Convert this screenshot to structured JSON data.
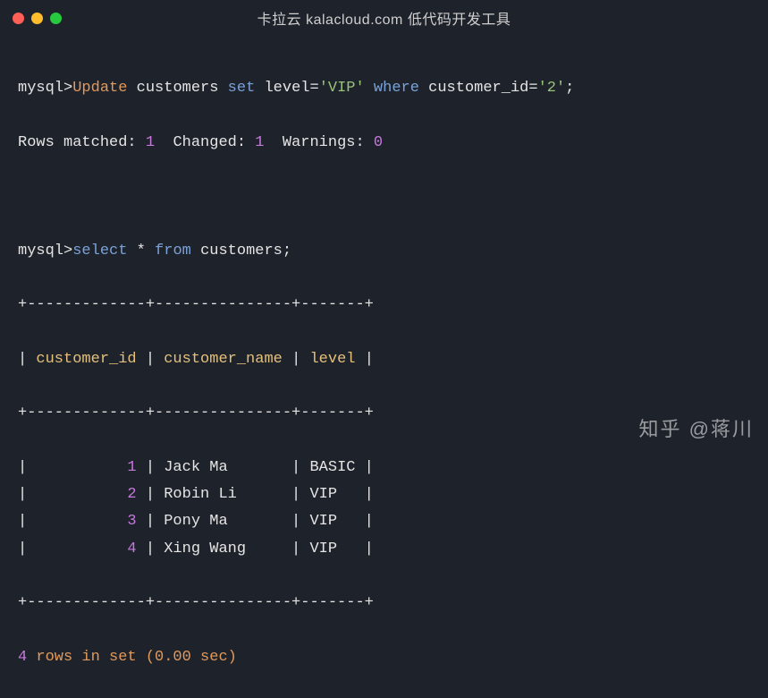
{
  "window": {
    "title": "卡拉云 kalacloud.com 低代码开发工具"
  },
  "prompt": "mysql>",
  "query1": {
    "update": "Update",
    "table": "customers",
    "set": "set",
    "field": "level",
    "eq": "=",
    "val": "'VIP'",
    "where": "where",
    "cond_field": "customer_id",
    "cond_val": "'2'",
    "semicolon": ";"
  },
  "result1": {
    "matched_label": "Rows matched:",
    "matched": "1",
    "changed_label": "Changed:",
    "changed": "1",
    "warnings_label": "Warnings:",
    "warnings": "0"
  },
  "query2": {
    "select": "select",
    "star": "*",
    "from": "from",
    "table": "customers",
    "semicolon": ";"
  },
  "table": {
    "border_top": "+-------------+---------------+-------+",
    "border_mid": "+-------------+---------------+-------+",
    "border_bottom": "+-------------+---------------+-------+",
    "pipe": "|",
    "headers": {
      "col1": "customer_id",
      "col2": "customer_name",
      "col3": "level"
    },
    "rows": [
      {
        "id": "1",
        "name": "Jack Ma",
        "level": "BASIC"
      },
      {
        "id": "2",
        "name": "Robin Li",
        "level": "VIP"
      },
      {
        "id": "3",
        "name": "Pony Ma",
        "level": "VIP"
      },
      {
        "id": "4",
        "name": "Xing Wang",
        "level": "VIP"
      }
    ]
  },
  "footer": {
    "count": "4",
    "rows_in_set": "rows in set",
    "time": "0.00 sec"
  },
  "watermark": "知乎 @蒋川"
}
